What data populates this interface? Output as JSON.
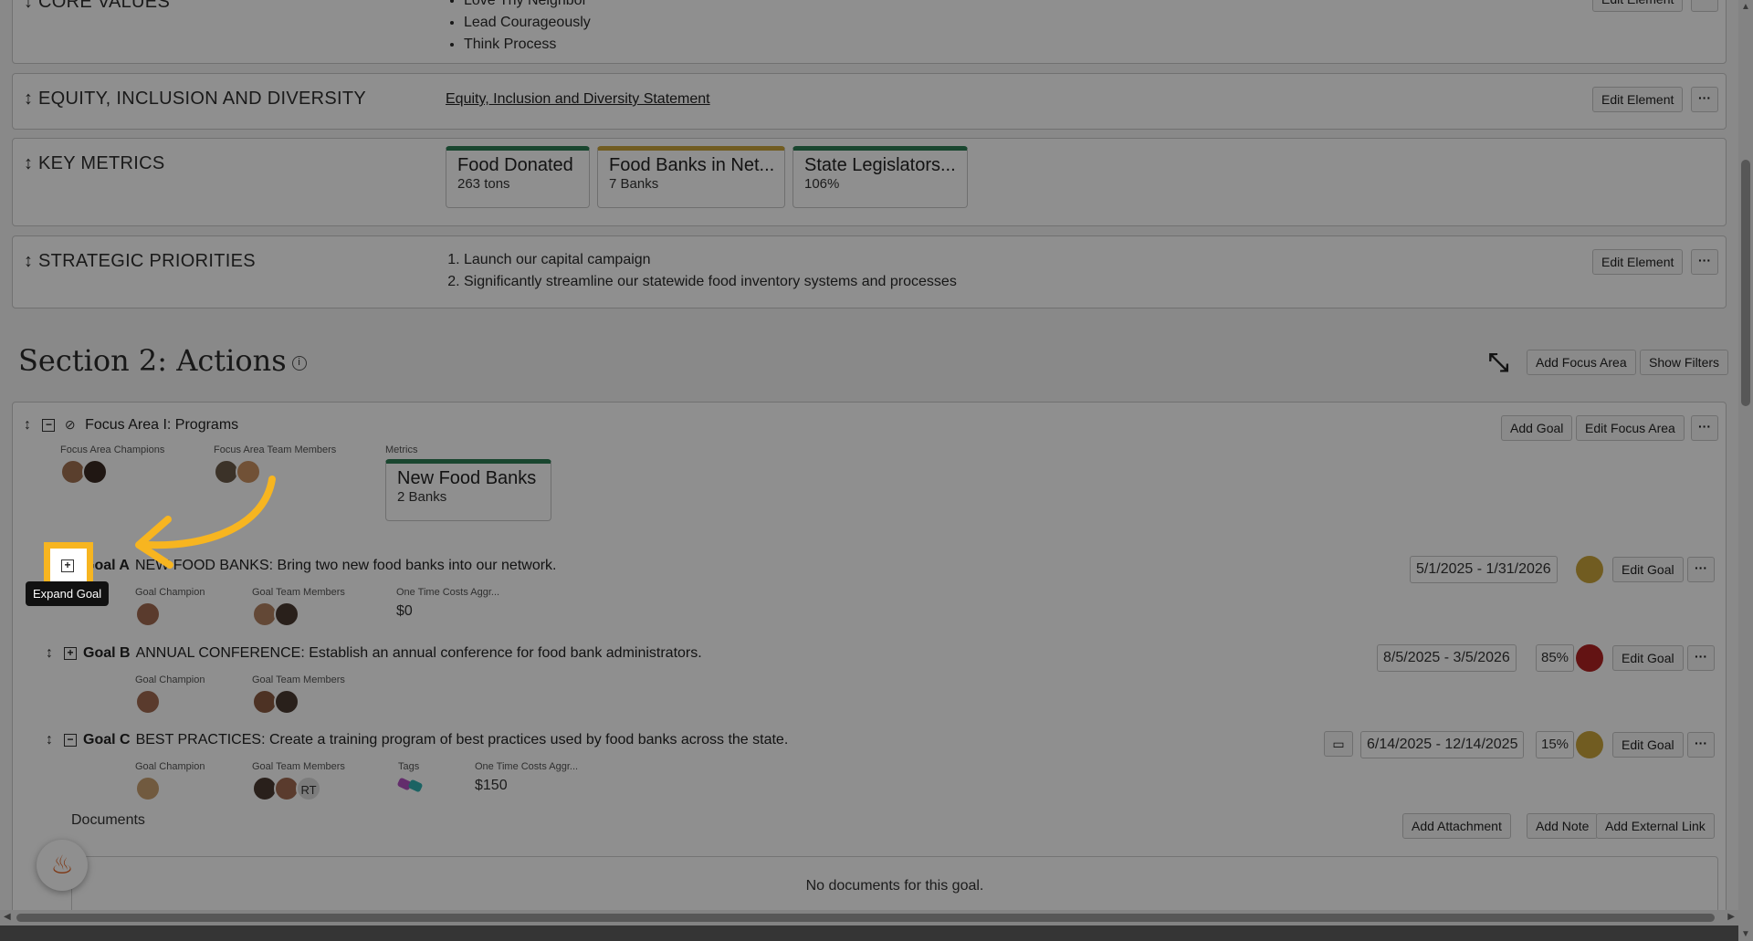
{
  "sections": {
    "core_values": {
      "title": "CORE VALUES",
      "items": [
        "Love Thy Neighbor",
        "Lead Courageously",
        "Think Process"
      ],
      "edit_label": "Edit Element",
      "more_label": "···"
    },
    "equity": {
      "title": "EQUITY, INCLUSION AND DIVERSITY",
      "link": "Equity, Inclusion and Diversity Statement",
      "edit_label": "Edit Element",
      "more_label": "···"
    },
    "key_metrics": {
      "title": "KEY METRICS",
      "metrics": [
        {
          "name": "Food Donated",
          "value": "263 tons",
          "color": "#2d7d55"
        },
        {
          "name": "Food Banks in Net...",
          "value": "7 Banks",
          "color": "#c9a53b"
        },
        {
          "name": "State Legislators...",
          "value": "106%",
          "color": "#2d7d55"
        }
      ]
    },
    "strategic": {
      "title": "STRATEGIC PRIORITIES",
      "items": [
        "Launch our capital campaign",
        "Significantly streamline our statewide food inventory systems and processes"
      ],
      "edit_label": "Edit Element",
      "more_label": "···"
    }
  },
  "actions": {
    "title": "Section 2: Actions",
    "info_icon": "i",
    "add_focus_area": "Add Focus Area",
    "show_filters": "Show Filters",
    "focus_area": {
      "title": "Focus Area I: Programs",
      "champions_label": "Focus Area Champions",
      "team_label": "Focus Area Team Members",
      "metrics_label": "Metrics",
      "metric": {
        "name": "New Food Banks",
        "value": "2 Banks"
      },
      "add_goal": "Add Goal",
      "edit_focus_area": "Edit Focus Area",
      "more_label": "···"
    },
    "goals": [
      {
        "id": "Goal A",
        "text": "NEW FOOD BANKS: Bring two new food banks into our network.",
        "champion_label": "Goal Champion",
        "team_label": "Goal Team Members",
        "cost_label": "One Time Costs Aggr...",
        "cost": "$0",
        "dates": "5/1/2025 - 1/31/2026",
        "status_color": "#c9a53b",
        "edit_label": "Edit Goal",
        "more_label": "···"
      },
      {
        "id": "Goal B",
        "text": "ANNUAL CONFERENCE: Establish an annual conference for food bank administrators.",
        "champion_label": "Goal Champion",
        "team_label": "Goal Team Members",
        "dates": "8/5/2025 - 3/5/2026",
        "percent": "85%",
        "status_color": "#b02222",
        "edit_label": "Edit Goal",
        "more_label": "···"
      },
      {
        "id": "Goal C",
        "text": "BEST PRACTICES: Create a training program of best practices used by food banks across the state.",
        "champion_label": "Goal Champion",
        "team_label": "Goal Team Members",
        "tags_label": "Tags",
        "cost_label": "One Time Costs Aggr...",
        "cost": "$150",
        "member_initials": "RT",
        "dates": "6/14/2025 - 12/14/2025",
        "percent": "15%",
        "status_color": "#c9a53b",
        "edit_label": "Edit Goal",
        "more_label": "···"
      }
    ],
    "documents": {
      "title": "Documents",
      "add_attachment": "Add Attachment",
      "add_note": "Add Note",
      "add_external_link": "Add External Link",
      "empty": "No documents for this goal."
    }
  },
  "tooltip": "Expand Goal",
  "icons": {
    "drag": "drag-handle-icon",
    "expand": "expand-icon",
    "collapse": "collapse-icon",
    "compress": "compress-icon",
    "hidden": "eye-slash-icon",
    "comment": "comment-icon",
    "fire": "fire-icon"
  },
  "colors": {
    "highlight": "#f7b520",
    "accent_green": "#2d7d55",
    "gold": "#c9a53b",
    "red": "#b02222"
  }
}
